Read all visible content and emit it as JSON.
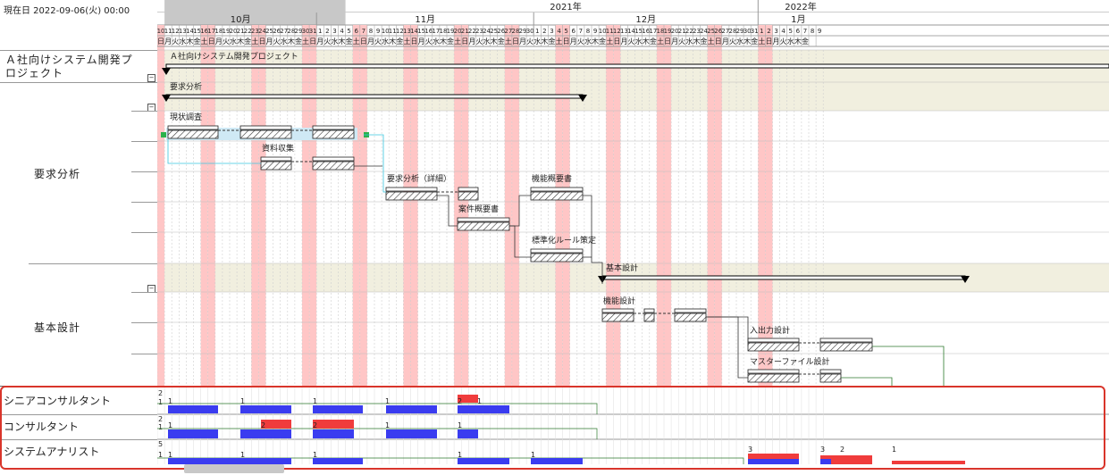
{
  "header": {
    "current_date": "現在日 2022-09-06(火) 00:00",
    "years": [
      "2021年",
      "2022年"
    ],
    "months": [
      "10月",
      "11月",
      "12月",
      "1月"
    ]
  },
  "calendar": {
    "day_numbers": [
      "10",
      "11",
      "12",
      "13",
      "14",
      "15",
      "16",
      "17",
      "18",
      "19",
      "20",
      "21",
      "22",
      "23",
      "24",
      "25",
      "26",
      "27",
      "28",
      "29",
      "30",
      "31",
      "1",
      "2",
      "3",
      "4",
      "5",
      "6",
      "7",
      "8",
      "9",
      "10",
      "11",
      "12",
      "13",
      "14",
      "15",
      "16",
      "17",
      "18",
      "19",
      "20",
      "21",
      "22",
      "23",
      "24",
      "25",
      "26",
      "27",
      "28",
      "29",
      "30",
      "1",
      "2",
      "3",
      "4",
      "5",
      "6",
      "7",
      "8",
      "9",
      "10",
      "11",
      "12",
      "13",
      "14",
      "15",
      "16",
      "17",
      "18",
      "19",
      "20",
      "21",
      "22",
      "23",
      "24",
      "25",
      "26",
      "27",
      "28",
      "29",
      "30",
      "31",
      "1",
      "2",
      "3",
      "4",
      "5",
      "6",
      "7",
      "8",
      "9"
    ],
    "weekdays": [
      "日",
      "月",
      "火",
      "水",
      "木",
      "金",
      "土",
      "日",
      "月",
      "火",
      "水",
      "木",
      "金",
      "土",
      "日",
      "月",
      "火",
      "水",
      "木",
      "金",
      "土",
      "日",
      "月",
      "火",
      "水",
      "木",
      "金",
      "土",
      "日",
      "月",
      "火",
      "水",
      "木",
      "金",
      "土",
      "日",
      "月",
      "火",
      "水",
      "木",
      "金",
      "土",
      "日",
      "月",
      "火",
      "水",
      "木",
      "金",
      "土",
      "日",
      "月",
      "火",
      "水",
      "木",
      "金",
      "土",
      "日",
      "月",
      "火",
      "水",
      "木",
      "金",
      "土",
      "日",
      "月",
      "火",
      "水",
      "木",
      "金",
      "土",
      "日",
      "月",
      "火",
      "水",
      "木",
      "金",
      "土",
      "日",
      "月",
      "火",
      "水",
      "木",
      "金",
      "土",
      "日",
      "月",
      "火",
      "水",
      "木",
      "金"
    ]
  },
  "tree": {
    "project": "Ａ社向けシステム開発プロジェクト",
    "groups": [
      "要求分析",
      "基本設計"
    ]
  },
  "tasks": {
    "project_bar": "Ａ社向けシステム開発プロジェクト",
    "req_summary": "要求分析",
    "genjou": "現状調査",
    "shiryou": "資料収集",
    "youkyuu_shousai": "要求分析（詳細）",
    "kinou_gaiyou": "機能概要書",
    "anken_gaiyou": "案件概要書",
    "hyoujunka": "標準化ルール策定",
    "kihon_summary": "基本設計",
    "kinou_sekkei": "機能設計",
    "nyuushutsu": "入出力設計",
    "master_file": "マスターファイル設計"
  },
  "resources": [
    {
      "name": "シニアコンサルタント",
      "max": "2",
      "unit": "1",
      "labels": [
        "1",
        "1",
        "1",
        "1",
        "2",
        "1"
      ]
    },
    {
      "name": "コンサルタント",
      "max": "2",
      "unit": "1",
      "labels": [
        "1",
        "2",
        "2",
        "1",
        "1"
      ]
    },
    {
      "name": "システムアナリスト",
      "max": "5",
      "unit": "1",
      "labels": [
        "1",
        "1",
        "1",
        "1",
        "1",
        "3",
        "3",
        "2",
        "1"
      ]
    }
  ],
  "colors": {
    "weekend": "#ffc6c6",
    "summary_band": "#f1efdf",
    "bar_blue": "#3a3cf0",
    "bar_red": "#f03c3c",
    "frame_red": "#d9352b"
  }
}
